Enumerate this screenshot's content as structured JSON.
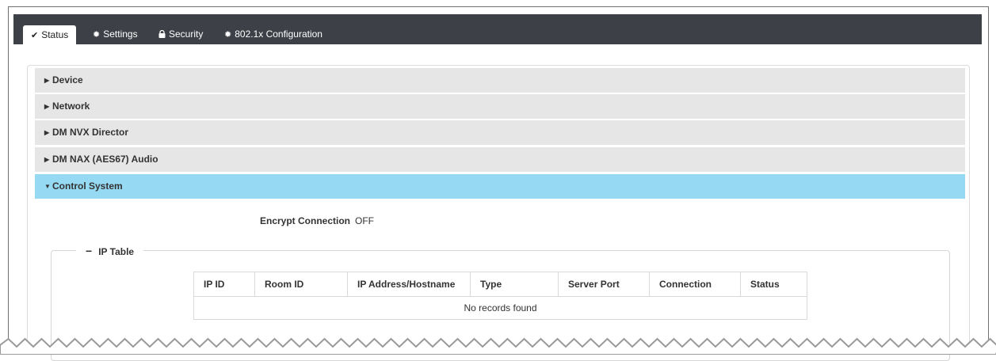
{
  "tabs": [
    {
      "label": "Status",
      "icon": "check-icon",
      "active": true
    },
    {
      "label": "Settings",
      "icon": "gear-icon",
      "active": false
    },
    {
      "label": "Security",
      "icon": "lock-icon",
      "active": false
    },
    {
      "label": "802.1x Configuration",
      "icon": "gear-icon",
      "active": false
    }
  ],
  "sections": [
    {
      "label": "Device",
      "expanded": false
    },
    {
      "label": "Network",
      "expanded": false
    },
    {
      "label": "DM NVX Director",
      "expanded": false
    },
    {
      "label": "DM NAX (AES67) Audio",
      "expanded": false
    },
    {
      "label": "Control System",
      "expanded": true
    }
  ],
  "control_system": {
    "encrypt_label": "Encrypt Connection",
    "encrypt_value": "OFF",
    "ip_table": {
      "legend": "IP Table",
      "columns": [
        "IP ID",
        "Room ID",
        "IP Address/Hostname",
        "Type",
        "Server Port",
        "Connection",
        "Status"
      ],
      "empty_message": "No records found"
    }
  },
  "colors": {
    "tabbar_bg": "#3d4147",
    "section_bg": "#e6e6e6",
    "section_open_bg": "#96d9f3"
  }
}
